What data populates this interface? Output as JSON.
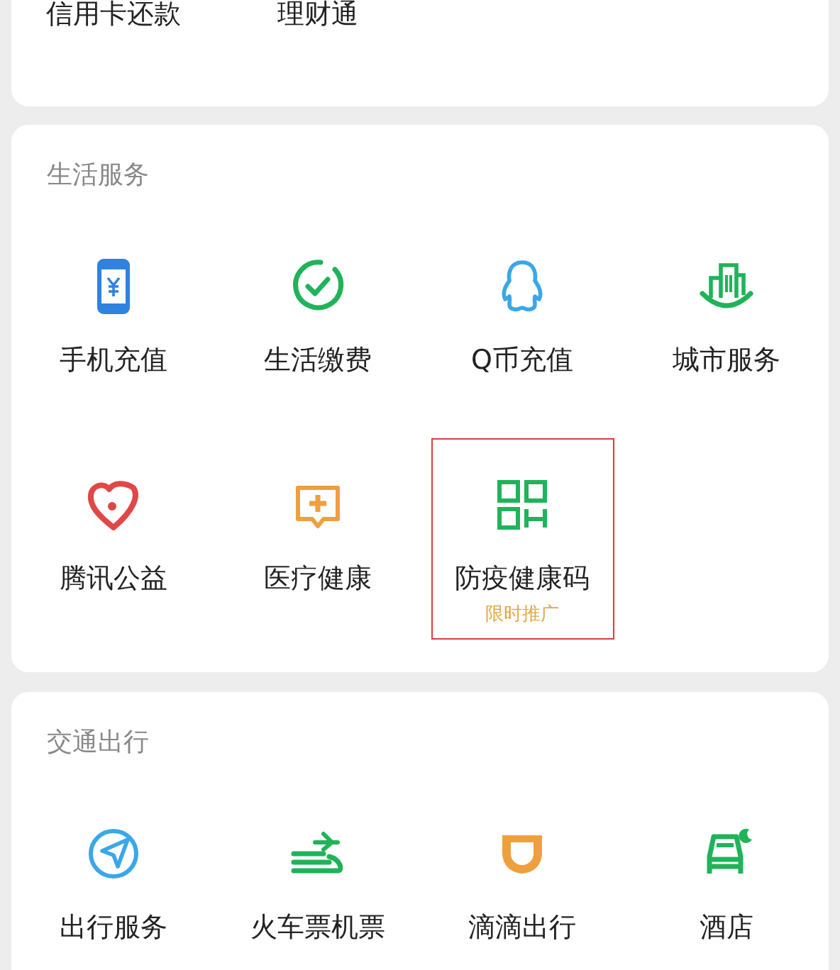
{
  "top_items": [
    {
      "label": "信用卡还款"
    },
    {
      "label": "理财通"
    }
  ],
  "sections": [
    {
      "title": "生活服务",
      "items": [
        {
          "label": "手机充值",
          "highlighted": false
        },
        {
          "label": "生活缴费",
          "highlighted": false
        },
        {
          "label": "Q币充值",
          "highlighted": false
        },
        {
          "label": "城市服务",
          "highlighted": false
        },
        {
          "label": "腾讯公益",
          "highlighted": false
        },
        {
          "label": "医疗健康",
          "highlighted": false
        },
        {
          "label": "防疫健康码",
          "sublabel": "限时推广",
          "highlighted": true
        }
      ]
    },
    {
      "title": "交通出行",
      "items": [
        {
          "label": "出行服务",
          "highlighted": false
        },
        {
          "label": "火车票机票",
          "highlighted": false
        },
        {
          "label": "滴滴出行",
          "highlighted": false
        },
        {
          "label": "酒店",
          "highlighted": false
        }
      ]
    }
  ]
}
